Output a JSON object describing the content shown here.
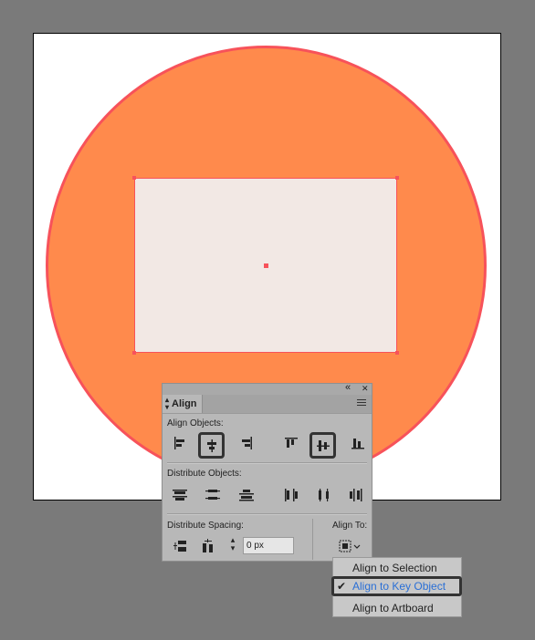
{
  "panel": {
    "tab_title": "Align",
    "align_objects_label": "Align Objects:",
    "distribute_objects_label": "Distribute Objects:",
    "distribute_spacing_label": "Distribute Spacing:",
    "align_to_label": "Align To:",
    "spacing_value": "0 px",
    "collapse_icon": "«",
    "close_icon": "✕"
  },
  "dropdown": {
    "items": [
      {
        "label": "Align to Selection",
        "checked": false
      },
      {
        "label": "Align to Key Object",
        "checked": true
      },
      {
        "label": "Align to Artboard",
        "checked": false
      }
    ],
    "checkmark": "✔"
  },
  "colors": {
    "background": "#7a7a7a",
    "circle_fill": "#ff8a4c",
    "circle_stroke": "#f7525a",
    "rect_fill": "#f2e8e4",
    "selected_text": "#2a6fd6"
  }
}
